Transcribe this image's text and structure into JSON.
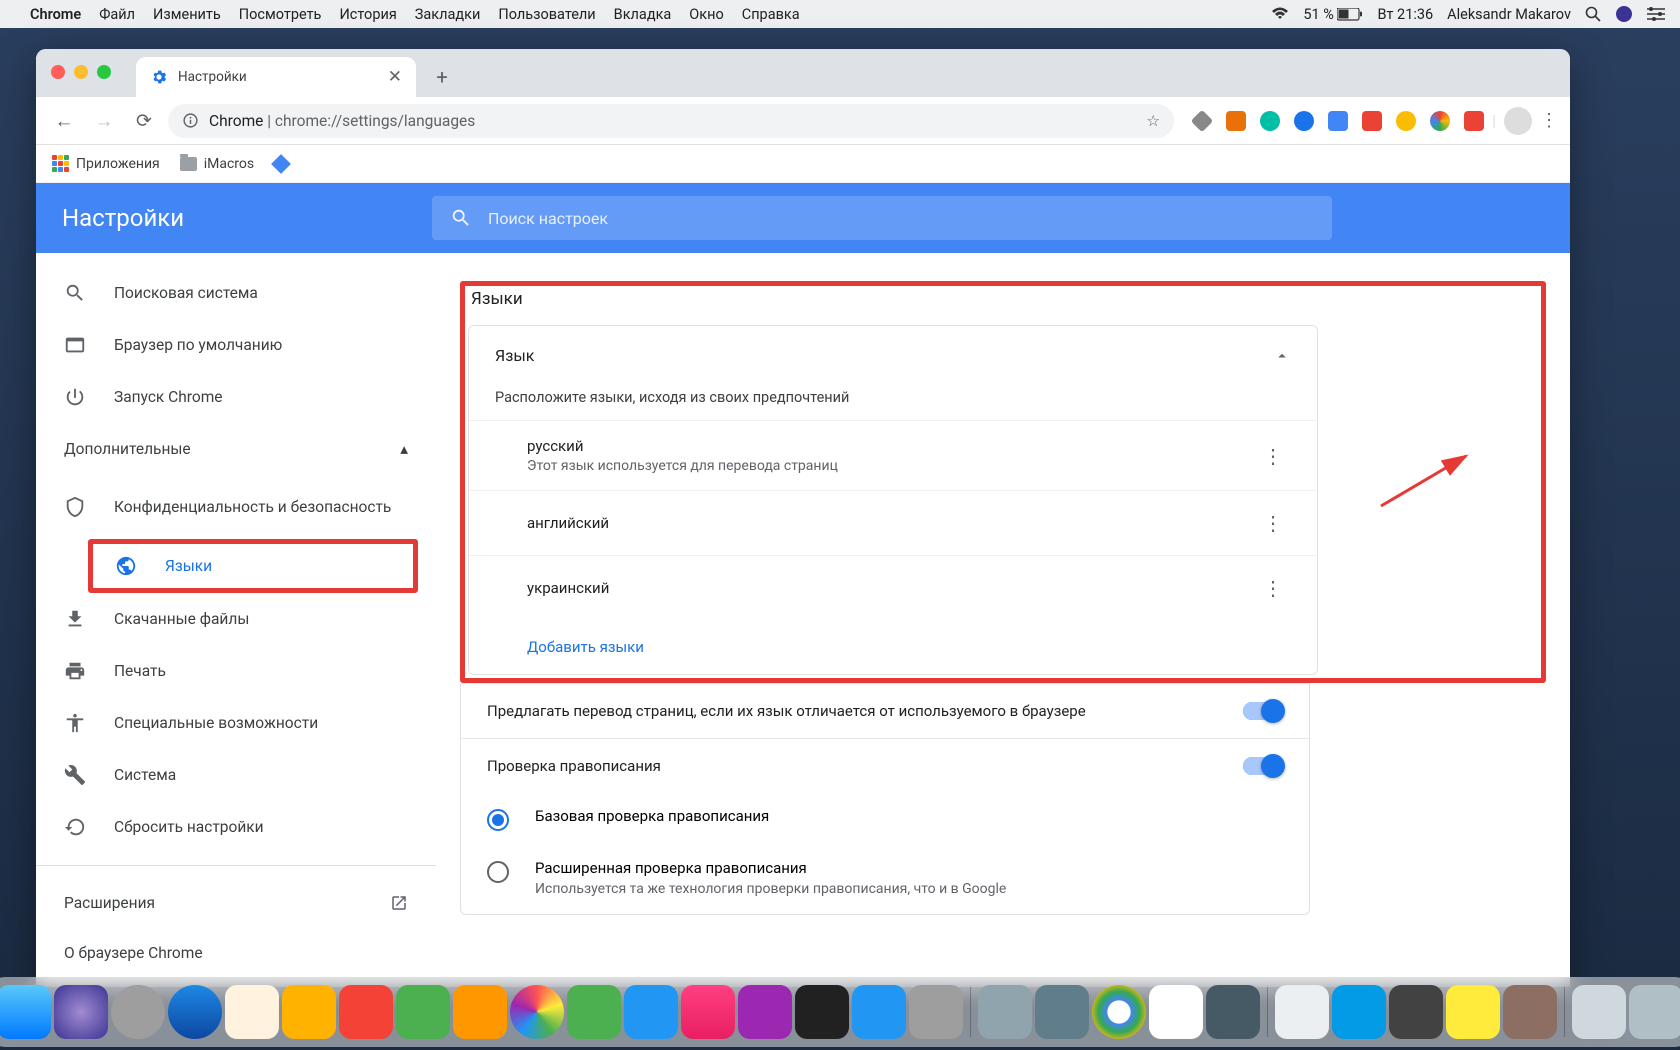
{
  "menubar": {
    "app": "Chrome",
    "items": [
      "Файл",
      "Изменить",
      "Посмотреть",
      "История",
      "Закладки",
      "Пользователи",
      "Вкладка",
      "Окно",
      "Справка"
    ],
    "battery": "51 %",
    "datetime": "Вт 21:36",
    "user": "Aleksandr Makarov"
  },
  "tab": {
    "title": "Настройки"
  },
  "omnibox": {
    "prefix": "Chrome",
    "url": "chrome://settings/languages"
  },
  "bookmarks": {
    "apps": "Приложения",
    "imacros": "iMacros"
  },
  "settings": {
    "title": "Настройки",
    "search_placeholder": "Поиск настроек",
    "nav": {
      "search_engine": "Поисковая система",
      "default_browser": "Браузер по умолчанию",
      "startup": "Запуск Chrome",
      "advanced": "Дополнительные",
      "privacy": "Конфиденциальность и безопасность",
      "languages": "Языки",
      "downloads": "Скачанные файлы",
      "print": "Печать",
      "accessibility": "Специальные возможности",
      "system": "Система",
      "reset": "Сбросить настройки",
      "extensions": "Расширения",
      "about": "О браузере Chrome"
    },
    "main": {
      "panel_title": "Языки",
      "section_label": "Язык",
      "order_hint": "Расположите языки, исходя из своих предпочтений",
      "langs": [
        {
          "name": "русский",
          "desc": "Этот язык используется для перевода страниц"
        },
        {
          "name": "английский",
          "desc": ""
        },
        {
          "name": "украинский",
          "desc": ""
        }
      ],
      "add": "Добавить языки",
      "translate_offer": "Предлагать перевод страниц, если их язык отличается от используемого в браузере",
      "spellcheck": "Проверка правописания",
      "spell_basic": "Базовая проверка правописания",
      "spell_ext": "Расширенная проверка правописания",
      "spell_ext_desc": "Используется та же технология проверки правописания, что и в Google"
    }
  }
}
